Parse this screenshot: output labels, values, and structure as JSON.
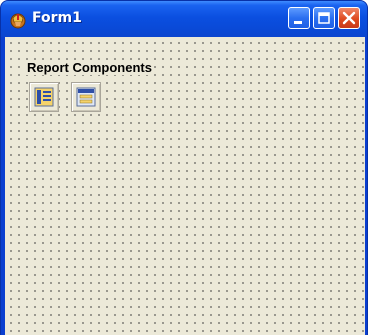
{
  "window": {
    "title": "Form1",
    "icon": "delphi-helmet-icon",
    "controls": [
      "minimize-button",
      "maximize-button",
      "close-button"
    ]
  },
  "form": {
    "label": "Report Components",
    "components": [
      {
        "name": "report-component-1",
        "icon": "report-band-icon"
      },
      {
        "name": "report-component-2",
        "icon": "report-page-icon"
      }
    ]
  },
  "colors": {
    "titlebar": "#0b4fe0",
    "client": "#ece9d8",
    "close": "#de4a1f"
  }
}
